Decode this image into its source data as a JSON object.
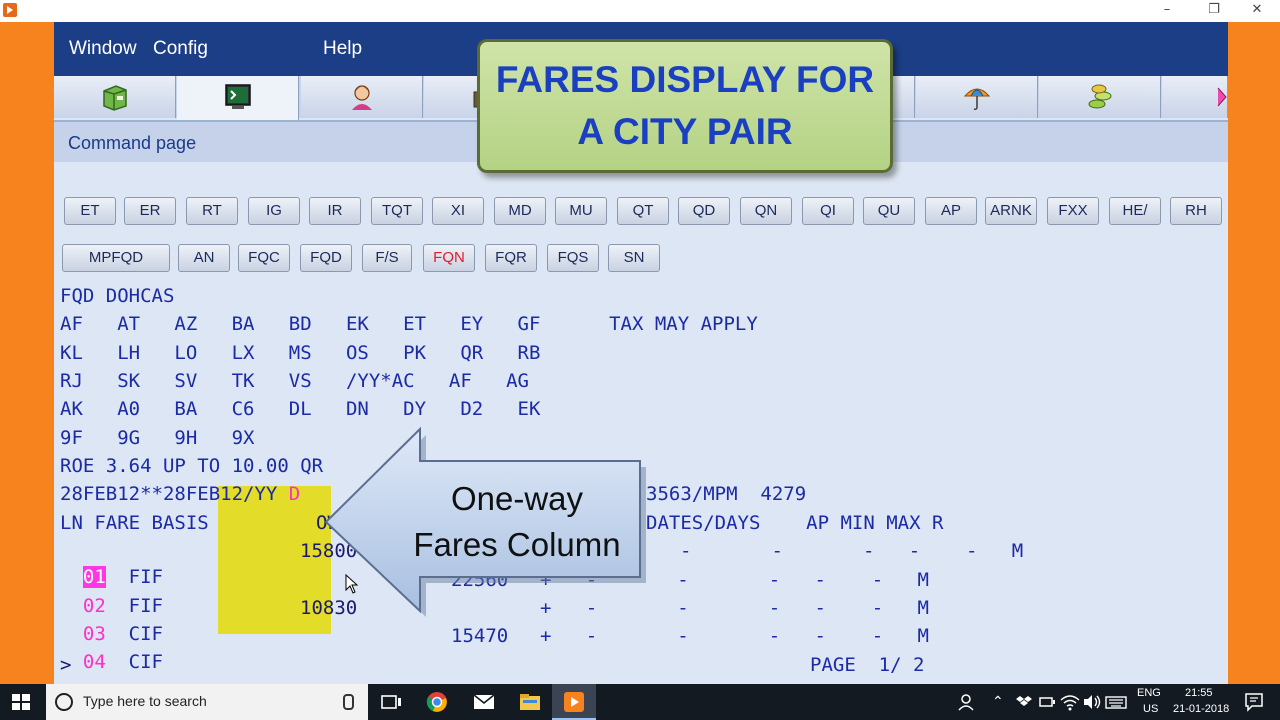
{
  "window": {
    "minimize": "–",
    "maximize": "❐",
    "close": "✕"
  },
  "menu": {
    "items": [
      "Window",
      "Config",
      "Help"
    ]
  },
  "tabs": {
    "icons": [
      "book-icon",
      "terminal-icon",
      "agent-icon",
      "briefcase-icon",
      "umbrella-icon",
      "coins-icon"
    ]
  },
  "command_page": {
    "title": "Command page"
  },
  "buttons_row1": [
    "ET",
    "ER",
    "RT",
    "IG",
    "IR",
    "TQT",
    "XI",
    "MD",
    "MU",
    "QT",
    "QD",
    "QN",
    "QI",
    "QU",
    "AP",
    "ARNK",
    "FXX",
    "HE/",
    "RH"
  ],
  "buttons_row2": [
    "MPFQD",
    "AN",
    "FQC",
    "FQD",
    "F/S",
    "FQN",
    "FQR",
    "FQS",
    "SN"
  ],
  "terminal": {
    "line1": "FQD DOHCAS",
    "line2": "AF   AT   AZ   BA   BD   EK   ET   EY   GF      TAX MAY APPLY",
    "line3": "KL   LH   LO   LX   MS   OS   PK   QR   RB",
    "line4": "RJ   SK   SV   TK   VS   /YY*AC   AF   AG",
    "line5": "AK   A0   BA   C6   DL   DN   DY   D2   EK",
    "line6": "9F   9G   9H   9X",
    "line7": "ROE 3.64 UP TO 10.00 QR",
    "line8a": "28FEB12**28FEB12/YY ",
    "line8b": "D",
    "line8c": "3563/MPM  4279",
    "header_left": "LN FARE BASIS",
    "header_ow": "OW",
    "header_right": "DATES/DAYS    AP MIN MAX R",
    "rows": [
      {
        "ln": "01",
        "basis": "FIF",
        "ow": "15800",
        "rt": "",
        "flags": "-       -       -   -    -   M"
      },
      {
        "ln": "02",
        "basis": "FIF",
        "ow": "",
        "rt": "22560",
        "flags": "+   -       -       -   -    -   M"
      },
      {
        "ln": "03",
        "basis": "CIF",
        "ow": "10830",
        "rt": "",
        "flags": "+   -       -       -   -    -   M"
      },
      {
        "ln": "04",
        "basis": "CIF",
        "ow": "",
        "rt": "15470",
        "flags": "+   -       -       -   -    -   M"
      }
    ],
    "prompt": ">",
    "page": "PAGE  1/ 2"
  },
  "overlay": {
    "title_line1": "FARES DISPLAY FOR",
    "title_line2": "A CITY PAIR",
    "arrow_line1": "One-way",
    "arrow_line2": "Fares Column"
  },
  "taskbar": {
    "search_placeholder": "Type here to search",
    "lang1": "ENG",
    "lang2": "US",
    "time": "21:55",
    "date": "21-01-2018"
  }
}
